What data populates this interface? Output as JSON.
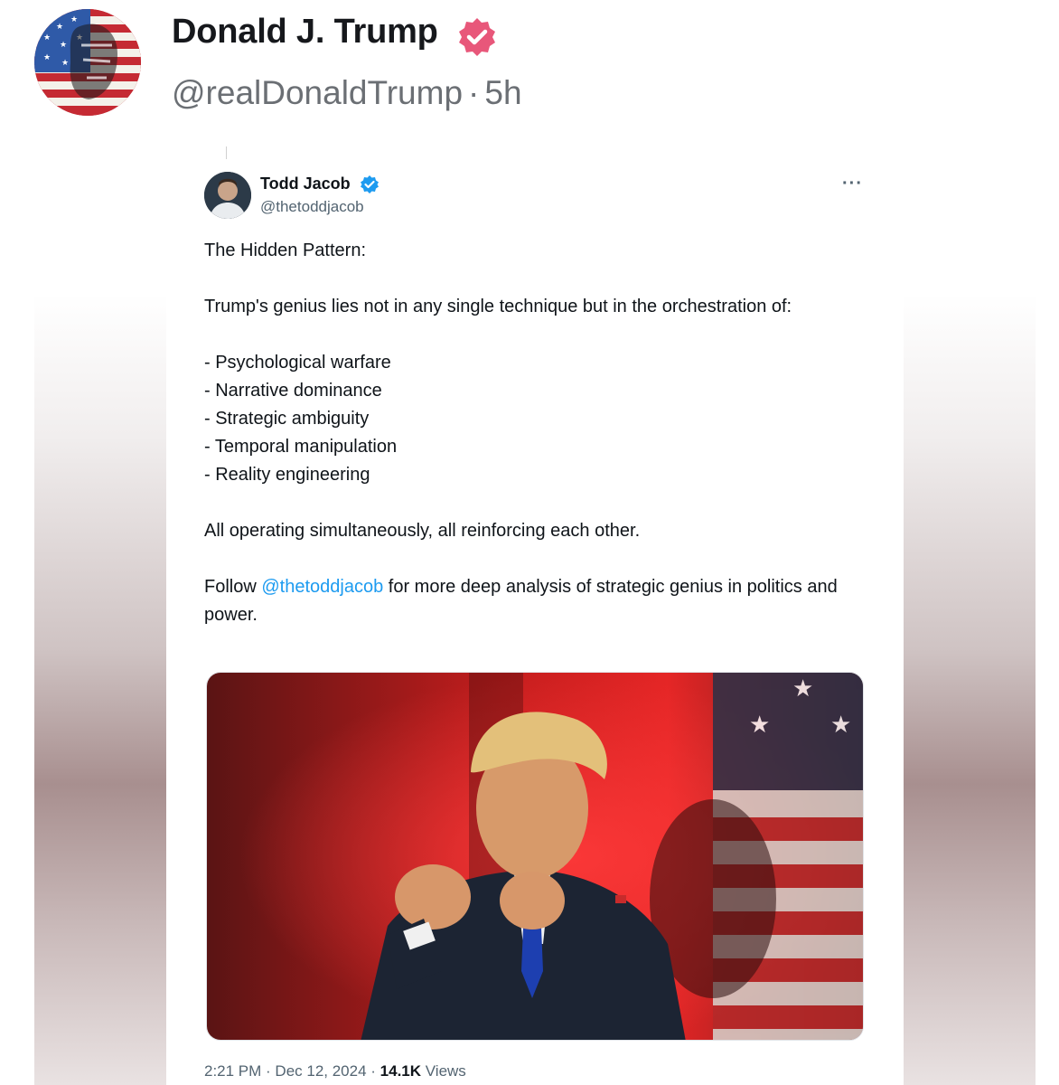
{
  "post": {
    "display_name": "Donald J. Trump",
    "handle": "@realDonaldTrump",
    "separator": "·",
    "time_ago": "5h",
    "verified_icon": "verified-badge-icon",
    "avatar_alt": "profile-avatar"
  },
  "quoted": {
    "display_name": "Todd Jacob",
    "handle": "@thetoddjacob",
    "more_label": "···",
    "text": {
      "line1": "The Hidden Pattern:",
      "line2": "Trump's genius lies not in any single technique but in the orchestration of:",
      "items": [
        "- Psychological warfare",
        "- Narrative dominance",
        "- Strategic ambiguity",
        "- Temporal manipulation",
        "- Reality engineering"
      ],
      "line3": "All operating simultaneously, all reinforcing each other.",
      "follow_prefix": "Follow ",
      "follow_mention": "@thetoddjacob",
      "follow_suffix": " for more deep analysis of strategic genius in politics and power."
    },
    "meta": {
      "time": "2:21 PM",
      "sep1": " · ",
      "date": "Dec 12, 2024",
      "sep2": " · ",
      "views_count": "14.1K",
      "views_label": " Views"
    }
  },
  "colors": {
    "accent": "#1d9bf0",
    "verified_outer": "#e8577a",
    "verified_inner": "#1d9bf0"
  }
}
